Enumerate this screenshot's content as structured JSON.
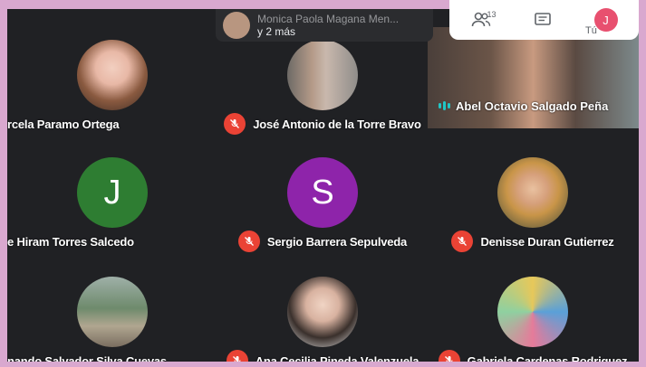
{
  "overlay": {
    "joiner_name": "Monica Paola Magana Men...",
    "joiner_more": "y 2 más"
  },
  "toolbar": {
    "participants_count": "13",
    "you_label": "Tú",
    "you_initial": "J"
  },
  "participants": [
    {
      "name": "rcela Paramo Ortega",
      "muted": false,
      "avatar": "photo"
    },
    {
      "name": "José Antonio de la Torre Bravo",
      "muted": true,
      "avatar": "photo"
    },
    {
      "name": "Abel Octavio Salgado Peña",
      "muted": false,
      "avatar": "video",
      "speaking": true
    },
    {
      "name": "e Hiram Torres Salcedo",
      "muted": false,
      "avatar": "letter",
      "initial": "J",
      "color": "#2e7d32"
    },
    {
      "name": "Sergio Barrera Sepulveda",
      "muted": true,
      "avatar": "letter",
      "initial": "S",
      "color": "#8e24aa"
    },
    {
      "name": "Denisse Duran Gutierrez",
      "muted": true,
      "avatar": "photo"
    },
    {
      "name": "nando Salvador Silva Cuevas",
      "muted": false,
      "avatar": "photo"
    },
    {
      "name": "Ana Cecilia Pineda Valenzuela",
      "muted": true,
      "avatar": "photo"
    },
    {
      "name": "Gabriela Cardenas Rodriguez",
      "muted": true,
      "avatar": "photo"
    }
  ],
  "colors": {
    "mic_off": "#ea4335",
    "background": "#202124",
    "frame": "#d9a8cf"
  }
}
